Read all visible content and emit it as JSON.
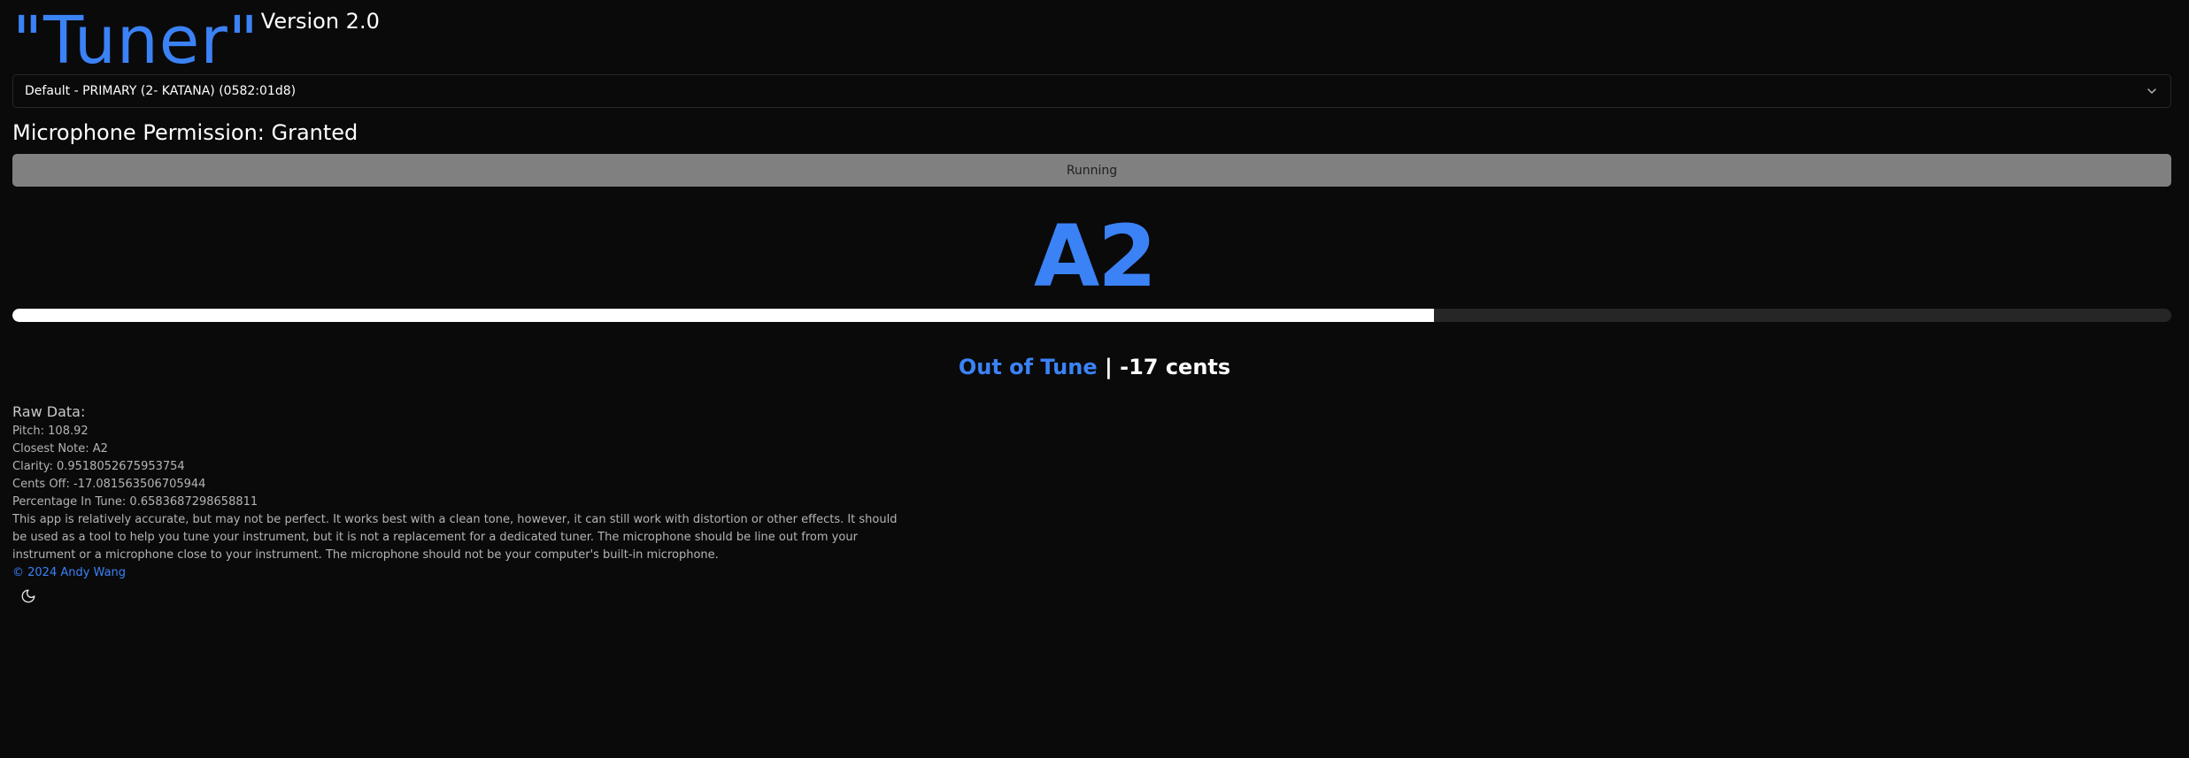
{
  "header": {
    "title": "\"Tuner\"",
    "version": "Version 2.0"
  },
  "device_select": {
    "selected": "Default - PRIMARY (2- KATANA) (0582:01d8)",
    "icon": "chevron-down-icon"
  },
  "permission": {
    "text": "Microphone Permission: Granted"
  },
  "run_button": {
    "label": "Running"
  },
  "note": {
    "value": "A2"
  },
  "tuning_bar": {
    "percent_in_tune": 0.6583687298658811
  },
  "tune_status": {
    "status": "Out of Tune",
    "separator": "|",
    "cents": "-17 cents"
  },
  "raw_data": {
    "title": "Raw Data:",
    "pitch": "Pitch: 108.92",
    "closest_note": "Closest Note: A2",
    "clarity": "Clarity: 0.9518052675953754",
    "cents_off": "Cents Off: -17.081563506705944",
    "percentage_in_tune": "Percentage In Tune: 0.6583687298658811"
  },
  "disclaimer": "This app is relatively accurate, but may not be perfect. It works best with a clean tone, however, it can still work with distortion or other effects. It should be used as a tool to help you tune your instrument, but it is not a replacement for a dedicated tuner. The microphone should be line out from your instrument or a microphone close to your instrument. The microphone should not be your computer's built-in microphone.",
  "footer": {
    "copyright": "© 2024 Andy Wang"
  },
  "theme_toggle": {
    "icon": "moon-icon"
  },
  "colors": {
    "accent": "#3b82f6",
    "background": "#0a0a0b",
    "button_bg": "#808080"
  }
}
